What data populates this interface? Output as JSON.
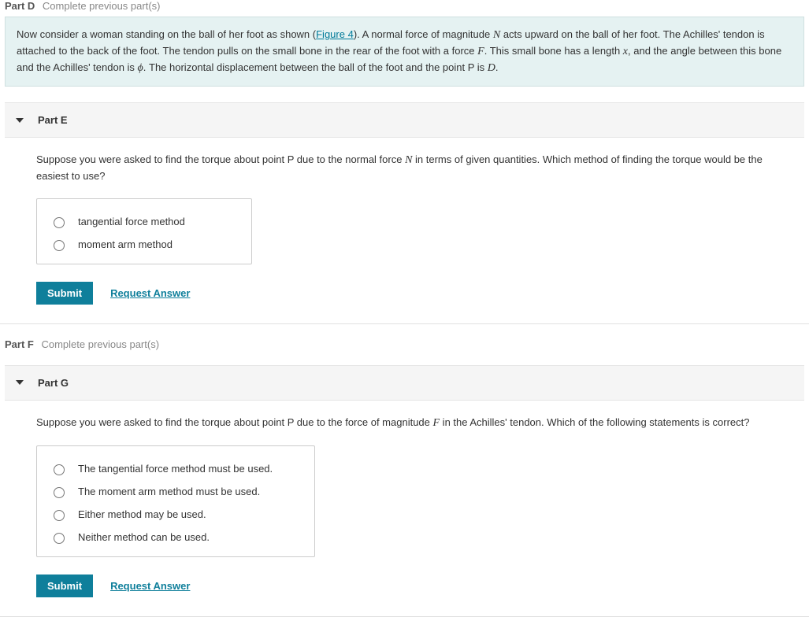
{
  "partD": {
    "label": "Part D",
    "status": "Complete previous part(s)"
  },
  "infoBox": {
    "pre": "Now consider a woman standing on the ball of her foot as shown (",
    "figLink": "Figure 4",
    "post1": "). A normal force of magnitude ",
    "varN": "N",
    "post2": " acts upward on the ball of her foot. The Achilles' tendon is attached to the back of the foot. The tendon pulls on the small bone in the rear of the foot with a force ",
    "varF": "F",
    "post3": ". This small bone has a length ",
    "varX": "x",
    "post4": ", and the angle between this bone and the Achilles' tendon is ",
    "varPhi": "ϕ",
    "post5": ". The horizontal displacement between the ball of the foot and the point P is ",
    "varD": "D",
    "post6": "."
  },
  "partE": {
    "label": "Part E",
    "question_pre": "Suppose you were asked to find the torque about point P due to the normal force ",
    "question_varN": "N",
    "question_post": " in terms of given quantities. Which method of finding the torque would be the easiest to use?",
    "options": {
      "o1": "tangential force method",
      "o2": "moment arm method"
    },
    "submit": "Submit",
    "request": "Request Answer"
  },
  "partF": {
    "label": "Part F",
    "status": "Complete previous part(s)"
  },
  "partG": {
    "label": "Part G",
    "question_pre": "Suppose you were asked to find the torque about point P due to the force of magnitude ",
    "question_varF": "F",
    "question_post": " in the Achilles' tendon. Which of the following statements is correct?",
    "options": {
      "o1": "The tangential force method must be used.",
      "o2": "The moment arm method must be used.",
      "o3": "Either method may be used.",
      "o4": "Neither method can be used."
    },
    "submit": "Submit",
    "request": "Request Answer"
  }
}
